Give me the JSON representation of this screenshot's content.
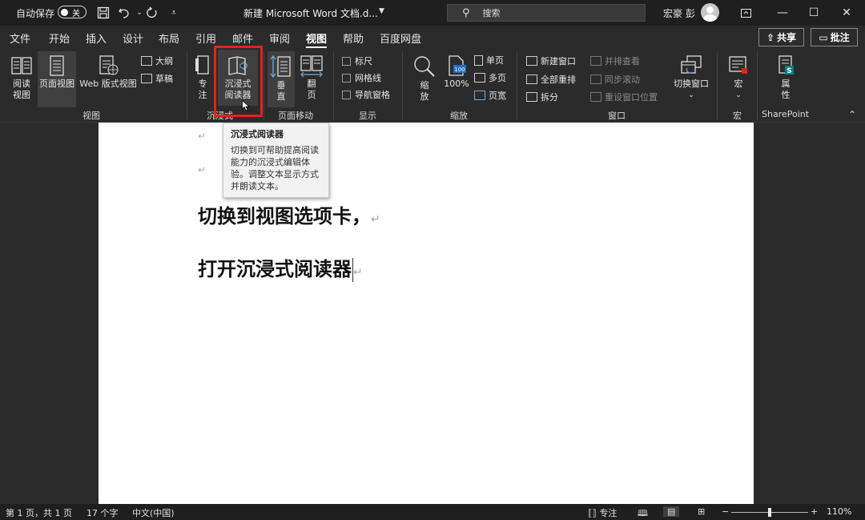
{
  "titlebar": {
    "autosave_label": "自动保存",
    "autosave_state": "关",
    "doc_title": "新建 Microsoft Word 文档.d...",
    "search_placeholder": "搜索",
    "user_name": "宏豪 彭",
    "icons": [
      "save-icon",
      "undo-icon",
      "redo-icon",
      "customize-icon"
    ]
  },
  "tabs": [
    "文件",
    "开始",
    "插入",
    "设计",
    "布局",
    "引用",
    "邮件",
    "审阅",
    "视图",
    "帮助",
    "百度网盘"
  ],
  "active_tab": "视图",
  "share_label": "共享",
  "comments_label": "批注",
  "ribbon": {
    "views": {
      "read_mode": "阅读\n视图",
      "print_layout": "页面视图",
      "web_layout": "Web 版式视图",
      "outline": "大纲",
      "draft": "草稿",
      "group": "视图"
    },
    "immersive": {
      "focus": "专\n注",
      "immersive_reader": "沉浸式\n阅读器",
      "group": "沉浸式"
    },
    "page_movement": {
      "vertical": "垂\n直",
      "side_to_side": "翻\n页",
      "group": "页面移动"
    },
    "show": {
      "ruler": "标尺",
      "gridlines": "网格线",
      "navigation_pane": "导航窗格",
      "group": "显示"
    },
    "zoom": {
      "zoom": "缩\n放",
      "hundred": "100%",
      "one_page": "单页",
      "multiple_pages": "多页",
      "page_width": "页宽",
      "group": "缩放"
    },
    "window": {
      "new_window": "新建窗口",
      "arrange_all": "全部重排",
      "split": "拆分",
      "side_by_side": "并排查看",
      "sync_scroll": "同步滚动",
      "reset_position": "重设窗口位置",
      "switch_windows": "切换窗口",
      "group": "窗口"
    },
    "macros": {
      "macros": "宏",
      "group": "宏"
    },
    "sharepoint": {
      "properties": "属\n性",
      "group": "SharePoint"
    }
  },
  "tooltip": {
    "title": "沉浸式阅读器",
    "body": "切换到可帮助提高阅读能力的沉浸式编辑体验。调整文本显示方式并朗读文本。"
  },
  "document": {
    "line1": "切换到视图选项卡，",
    "line2": "打开沉浸式阅读器",
    "paragraph_mark": "↵"
  },
  "status": {
    "page": "第 1 页，共 1 页",
    "words": "17 个字",
    "language": "中文(中国)",
    "focus": "专注",
    "zoom": "110%"
  },
  "colors": {
    "highlight_box": "#e2231a",
    "titlebar": "#1f1f1f",
    "ribbon": "#2b2b2b",
    "page": "#ffffff"
  }
}
